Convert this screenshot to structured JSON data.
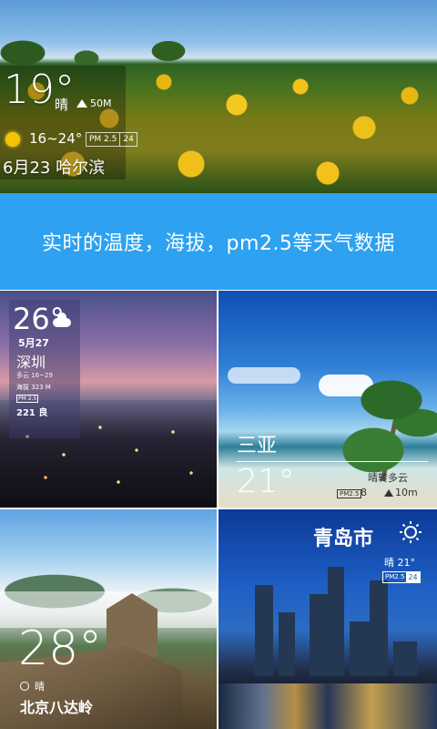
{
  "hero": {
    "temperature": "19°",
    "condition": "晴",
    "altitude": "50M",
    "temp_range": "16~24°",
    "pm_label": "PM 2.5",
    "pm_value": "24",
    "date_city": "6月23 哈尔滨"
  },
  "banner": {
    "text": "实时的温度，海拔，pm2.5等天气数据"
  },
  "tiles": [
    {
      "temperature": "26°",
      "date": "5月27",
      "city": "深圳",
      "range_line": "多云 16~29",
      "altitude_line": "海拔 323 M",
      "pm_label": "PM 2.5",
      "aqi": "221 良"
    },
    {
      "city": "三亚",
      "temperature": "21°",
      "condition": "晴转多云",
      "pm_label": "PM2.5",
      "pm_value": "8",
      "altitude": "10m"
    },
    {
      "temperature": "28°",
      "condition": "晴",
      "city": "北京八达岭"
    },
    {
      "city": "青岛市",
      "condition": "晴 21°",
      "pm_label": "PM2.5",
      "pm_value": "24"
    }
  ],
  "icons": [
    "sun-icon",
    "mountain-icon",
    "cloud-icon",
    "sun-outline-icon"
  ]
}
